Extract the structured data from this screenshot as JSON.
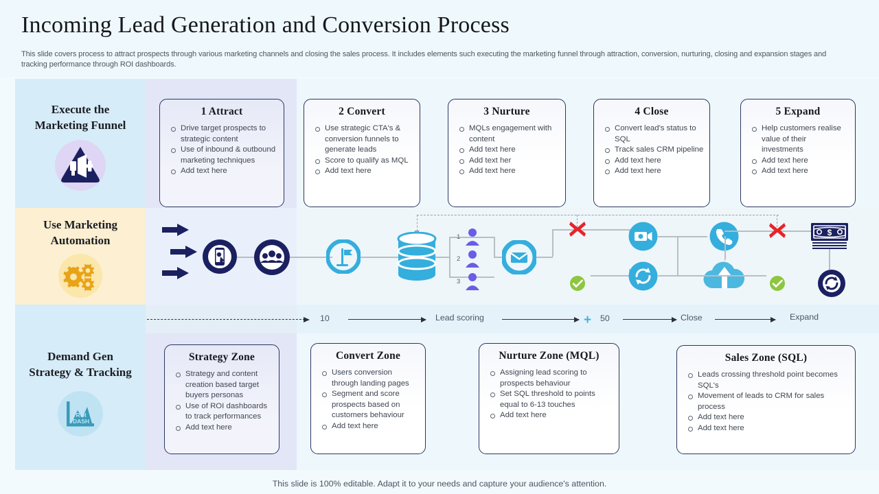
{
  "header": {
    "title": "Incoming Lead Generation and Conversion Process",
    "subtitle": "This slide covers process to attract prospects through various marketing channels and closing the sales process. It includes elements such executing the marketing funnel through attraction, conversion, nurturing, closing and expansion stages and tracking performance through ROI dashboards."
  },
  "sidebar": {
    "items": [
      {
        "label_line1": "Execute the",
        "label_line2": "Marketing Funnel",
        "icon": "megaphone-icon",
        "bg": "#d6ecf8",
        "icon_circle": "#ded6f4",
        "icon_color": "#1b2060"
      },
      {
        "label_line1": "Use Marketing",
        "label_line2": "Automation",
        "icon": "gears-icon",
        "bg": "#fcefd2",
        "icon_circle": "#fbe6ab",
        "icon_color": "#e8a317"
      },
      {
        "label_line1": "Demand Gen",
        "label_line2": "Strategy & Tracking",
        "icon": "roi-dashboard-chart-icon",
        "bg": "#d6ecf8",
        "icon_circle": "#bfe3f2",
        "icon_color": "#3a9bbb",
        "icon_text": "ROI DASH"
      }
    ]
  },
  "stages": [
    {
      "title": "1 Attract",
      "bullets": [
        "Drive  target prospects to strategic content",
        "Use of inbound  & outbound  marketing techniques",
        "Add text here"
      ]
    },
    {
      "title": "2 Convert",
      "bullets": [
        "Use strategic CTA's & conversion  funnels to generate  leads",
        "Score to qualify  as MQL",
        "Add text here"
      ]
    },
    {
      "title": "3 Nurture",
      "bullets": [
        "MQLs engagement with content",
        "Add text here",
        "Add text her",
        "Add text here"
      ]
    },
    {
      "title": "4 Close",
      "bullets": [
        "Convert  lead's status to SQL",
        "Track sales CRM pipeline",
        "Add text here",
        "Add text here"
      ]
    },
    {
      "title": "5 Expand",
      "bullets": [
        "Help customers realise value of their investments",
        "Add text here",
        "Add text here"
      ]
    }
  ],
  "timeline": {
    "score_10": "10",
    "lead_scoring": "Lead scoring",
    "plus": "+",
    "score_50": "50",
    "close": "Close",
    "expand": "Expand"
  },
  "diagram": {
    "person_numbers": [
      "1",
      "2",
      "3"
    ],
    "icons": [
      "inbound-arrows-icon",
      "mobile-touch-icon",
      "audience-group-icon",
      "landing-page-flag-icon",
      "database-icon",
      "lead-person-icon",
      "email-envelope-icon",
      "red-x-icon",
      "green-check-icon",
      "video-camera-icon",
      "refresh-cycle-icon",
      "phone-call-icon",
      "cloud-upload-icon",
      "money-cash-icon",
      "recycle-loop-icon"
    ],
    "colors": {
      "navy": "#1b2060",
      "cyan": "#34aedd",
      "red": "#e8232a",
      "green": "#8dc63f",
      "purple": "#6c5ce7"
    }
  },
  "zones": [
    {
      "title": "Strategy Zone",
      "bullets": [
        "Strategy and content creation  based target buyers personas",
        "Use of ROI dashboards  to track performances",
        "Add text here"
      ]
    },
    {
      "title": "Convert Zone",
      "bullets": [
        "Users conversion through landing  pages",
        "Segment  and score prospects based  on customers behaviour",
        "Add text here"
      ]
    },
    {
      "title": "Nurture Zone (MQL)",
      "bullets": [
        "Assigning lead  scoring to prospects behaviour",
        "Set SQL threshold to points equal to 6-13 touches",
        "Add text here"
      ]
    },
    {
      "title": "Sales Zone (SQL)",
      "bullets": [
        "Leads crossing threshold  point becomes SQL's",
        "Movement  of leads to CRM for  sales process",
        "Add text here",
        "Add text here"
      ]
    }
  ],
  "footer": {
    "note": "This slide is 100% editable. Adapt it to your needs and capture your audience's attention."
  }
}
